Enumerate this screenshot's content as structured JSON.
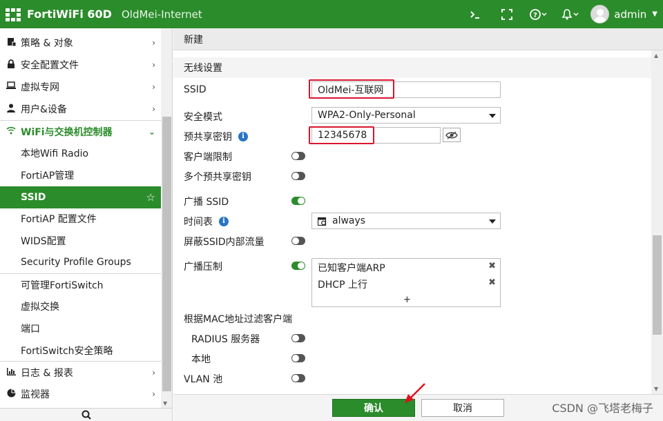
{
  "topbar": {
    "product": "FortiWiFi 60D",
    "hostname": "OldMei-Internet",
    "user": "admin",
    "icons": [
      "cli-console-icon",
      "fullscreen-icon",
      "help-icon",
      "notification-bell-icon",
      "avatar"
    ]
  },
  "sidebar": {
    "items": [
      {
        "label": "策略 & 对象",
        "icon": "policy-icon",
        "chevron": "›"
      },
      {
        "label": "安全配置文件",
        "icon": "lock-icon",
        "chevron": "›"
      },
      {
        "label": "虚拟专网",
        "icon": "laptop-icon",
        "chevron": "›"
      },
      {
        "label": "用户&设备",
        "icon": "user-icon",
        "chevron": "›"
      },
      {
        "label": "WiFi与交换机控制器",
        "icon": "wifi-icon",
        "chevron": "⌄"
      },
      {
        "label": "本地Wifi Radio"
      },
      {
        "label": "FortiAP管理"
      },
      {
        "label": "SSID",
        "star": "☆"
      },
      {
        "label": "FortiAP 配置文件"
      },
      {
        "label": "WIDS配置"
      },
      {
        "label": "Security Profile Groups"
      },
      {
        "label": "可管理FortiSwitch"
      },
      {
        "label": "虚拟交换"
      },
      {
        "label": "端口"
      },
      {
        "label": "FortiSwitch安全策略"
      },
      {
        "label": "日志 & 报表",
        "icon": "chart-icon",
        "chevron": "›"
      },
      {
        "label": "监视器",
        "icon": "pie-icon",
        "chevron": "›"
      }
    ]
  },
  "main": {
    "header": "新建",
    "section": "无线设置",
    "ssid_label": "SSID",
    "ssid_value": "OldMei-互联网",
    "security_mode_label": "安全模式",
    "security_mode_value": "WPA2-Only-Personal",
    "psk_label": "预共享密钥",
    "psk_value": "12345678",
    "client_limit_label": "客户端限制",
    "multi_psk_label": "多个预共享密钥",
    "broadcast_ssid_label": "广播 SSID",
    "schedule_label": "时间表",
    "schedule_value": "always",
    "block_intra_label": "屏蔽SSID内部流量",
    "broadcast_suppress_label": "广播压制",
    "suppress_items": [
      "已知客户端ARP",
      "DHCP 上行"
    ],
    "mac_filter_label": "根据MAC地址过滤客户端",
    "radius_label": "RADIUS 服务器",
    "local_label": "本地",
    "vlan_pool_label": "VLAN 池",
    "toggles": {
      "client_limit": false,
      "multi_psk": false,
      "broadcast_ssid": true,
      "block_intra": false,
      "broadcast_suppress": true,
      "radius": false,
      "local": false,
      "vlan_pool": false
    }
  },
  "footer": {
    "ok": "确认",
    "cancel": "取消"
  },
  "watermark": "CSDN @飞塔老梅子"
}
